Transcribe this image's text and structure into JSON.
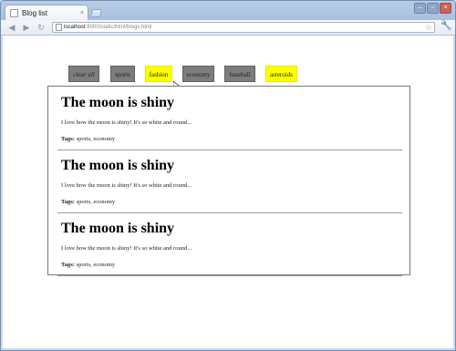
{
  "browser": {
    "tab_title": "Blog list",
    "tab_close": "×",
    "url_host": "localhost",
    "url_path": ":8000/static/html/blogs.html",
    "controls": {
      "minimize": "–",
      "maximize": "▫",
      "close": "×"
    },
    "icons": {
      "back": "back-arrow-icon",
      "forward": "forward-arrow-icon",
      "reload": "reload-icon",
      "star": "star-icon",
      "wrench": "wrench-icon"
    }
  },
  "tags": [
    {
      "label": "clear all",
      "active": false
    },
    {
      "label": "sports",
      "active": false
    },
    {
      "label": "fashion",
      "active": true
    },
    {
      "label": "economy",
      "active": false
    },
    {
      "label": "baseball",
      "active": false
    },
    {
      "label": "asteroids",
      "active": true
    }
  ],
  "posts": [
    {
      "title": "The moon is shiny",
      "body": "I love how the moon is shiny! It's so white and round...",
      "tags_label": "Tags:",
      "tags": "sports, economy"
    },
    {
      "title": "The moon is shiny",
      "body": "I love how the moon is shiny! It's so white and round...",
      "tags_label": "Tags:",
      "tags": "sports, economy"
    },
    {
      "title": "The moon is shiny",
      "body": "I love how the moon is shiny! It's so white and round...",
      "tags_label": "Tags:",
      "tags": "sports, economy"
    }
  ],
  "colors": {
    "tag_inactive": "#7d7d7d",
    "tag_active": "#ffff00",
    "window_frame": "#6f8fb8"
  }
}
